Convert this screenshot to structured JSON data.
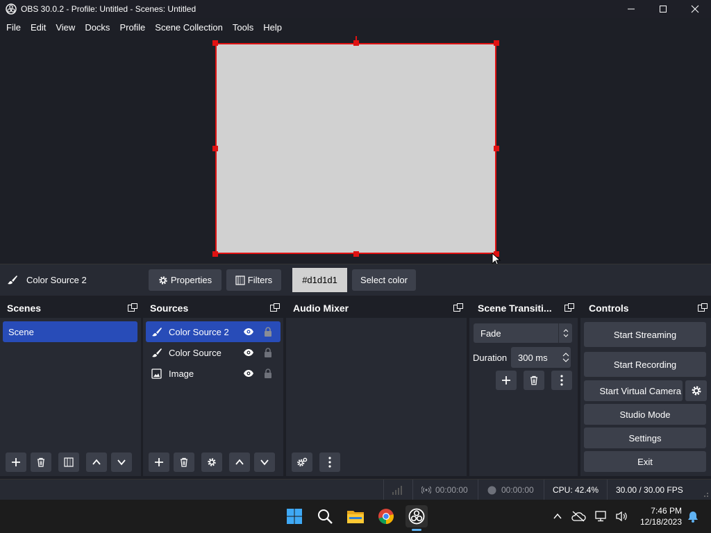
{
  "window": {
    "title": "OBS 30.0.2 - Profile: Untitled - Scenes: Untitled"
  },
  "menu": [
    "File",
    "Edit",
    "View",
    "Docks",
    "Profile",
    "Scene Collection",
    "Tools",
    "Help"
  ],
  "context_bar": {
    "source_name": "Color Source 2",
    "properties_label": "Properties",
    "filters_label": "Filters",
    "color_value": "#d1d1d1",
    "select_color_label": "Select color"
  },
  "preview": {
    "source_color": "#d1d1d1",
    "selection_color": "#e01212"
  },
  "scenes": {
    "header": "Scenes",
    "items": [
      "Scene"
    ]
  },
  "sources": {
    "header": "Sources",
    "items": [
      {
        "label": "Color Source 2",
        "icon": "brush-icon",
        "selected": true
      },
      {
        "label": "Color Source",
        "icon": "brush-icon",
        "selected": false
      },
      {
        "label": "Image",
        "icon": "image-icon",
        "selected": false
      }
    ]
  },
  "audio_mixer": {
    "header": "Audio Mixer"
  },
  "transitions": {
    "header": "Scene Transiti...",
    "selected": "Fade",
    "duration_label": "Duration",
    "duration_value": "300 ms"
  },
  "controls": {
    "header": "Controls",
    "start_streaming": "Start Streaming",
    "start_recording": "Start Recording",
    "start_virtual_camera": "Start Virtual Camera",
    "studio_mode": "Studio Mode",
    "settings": "Settings",
    "exit": "Exit"
  },
  "status": {
    "stream_time": "00:00:00",
    "record_time": "00:00:00",
    "cpu": "CPU: 42.4%",
    "fps": "30.00 / 30.00 FPS"
  },
  "taskbar": {
    "time": "7:46 PM",
    "date": "12/18/2023"
  },
  "colors": {
    "accent": "#284cb8",
    "panel": "#272a33",
    "background": "#1d1f26",
    "button": "#3c404b"
  }
}
